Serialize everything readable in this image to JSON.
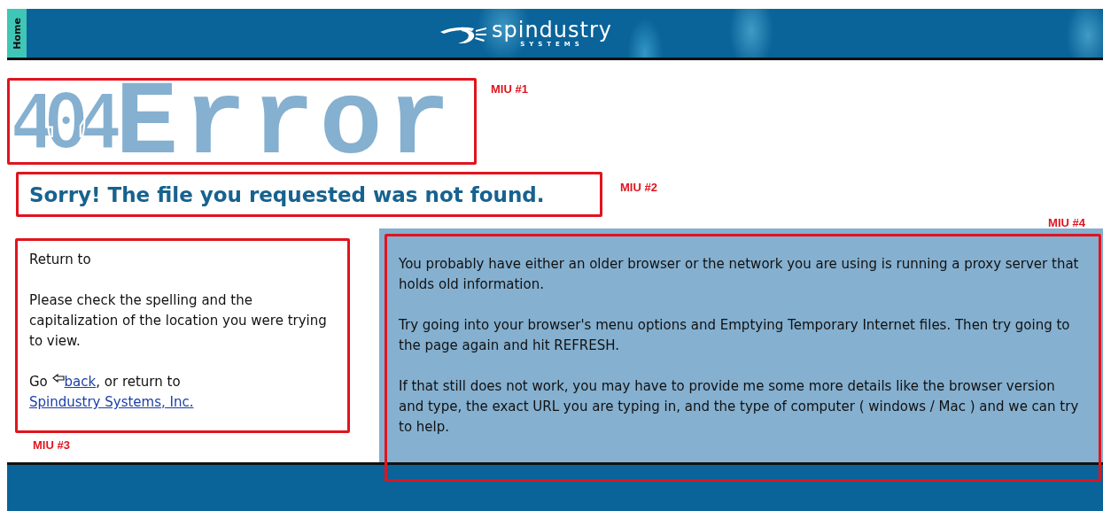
{
  "header": {
    "home_tab": "Home",
    "logo_name": "spindustry",
    "logo_tagline": "SYSTEMS"
  },
  "error_heading": {
    "code": "404",
    "word": "Error",
    "annotation": "MIU #1"
  },
  "message": {
    "text": "Sorry! The file you requested was not found.",
    "annotation": "MIU #2"
  },
  "help_box": {
    "return_to": "Return to",
    "hint": "Please check the spelling and the capitalization of the location you were trying to view.",
    "go_text": "Go ",
    "back_link": "back",
    "middle_text": ", or return to ",
    "home_link": "Spindustry Systems, Inc.",
    "annotation": "MIU #3"
  },
  "info_panel": {
    "annotation": "MIU #4",
    "paragraphs": [
      "You probably have either an older browser or the network you are using is running a proxy server that holds old information.",
      "Try going into your browser's menu options and Emptying Temporary Internet files. Then try going to the page again and hit REFRESH.",
      "If that still does not work, you may have to provide me some more details like the browser version and type, the exact URL you are typing in, and the type of computer ( windows / Mac ) and we can try to help."
    ]
  }
}
